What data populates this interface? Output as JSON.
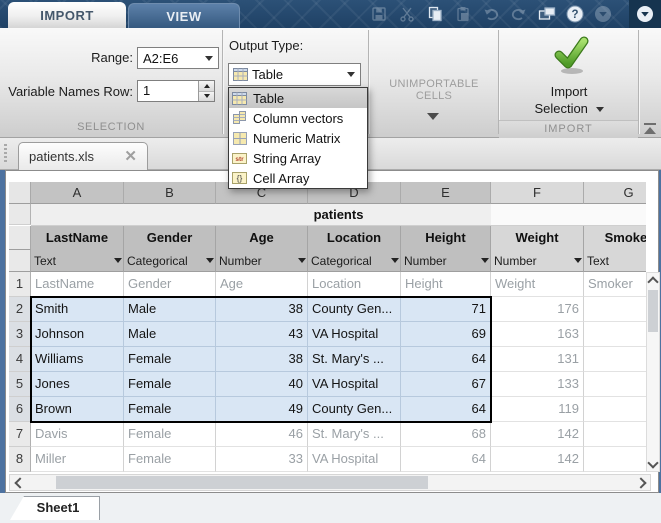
{
  "toolstrip": {
    "tabs": [
      {
        "label": "IMPORT",
        "active": true
      },
      {
        "label": "VIEW",
        "active": false
      }
    ],
    "selection_section": {
      "footer": "SELECTION",
      "range_label": "Range:",
      "range_value": "A2:E6",
      "var_names_label": "Variable Names Row:",
      "var_names_value": "1"
    },
    "output_type_section": {
      "label": "Output Type:",
      "selected": "Table",
      "options": [
        {
          "label": "Table",
          "icon": "table-icon",
          "selected": true
        },
        {
          "label": "Column vectors",
          "icon": "column-vectors-icon",
          "selected": false
        },
        {
          "label": "Numeric Matrix",
          "icon": "numeric-matrix-icon",
          "selected": false
        },
        {
          "label": "String Array",
          "icon": "string-array-icon",
          "selected": false
        },
        {
          "label": "Cell Array",
          "icon": "cell-array-icon",
          "selected": false
        }
      ]
    },
    "unimportable_section": {
      "label": "UNIMPORTABLE CELLS"
    },
    "import_section": {
      "footer": "IMPORT",
      "button_line1": "Import",
      "button_line2": "Selection"
    },
    "accent_colors": {
      "check_green": "#5fae2e",
      "band_navy": "#24486e"
    }
  },
  "document_tab": {
    "title": "patients.xls"
  },
  "spreadsheet": {
    "merged_title": "patients",
    "columns": [
      {
        "letter": "A",
        "name": "LastName",
        "type": "Text",
        "selected": true,
        "align": "left"
      },
      {
        "letter": "B",
        "name": "Gender",
        "type": "Categorical",
        "selected": true,
        "align": "left"
      },
      {
        "letter": "C",
        "name": "Age",
        "type": "Number",
        "selected": true,
        "align": "right"
      },
      {
        "letter": "D",
        "name": "Location",
        "type": "Categorical",
        "selected": true,
        "align": "left"
      },
      {
        "letter": "E",
        "name": "Height",
        "type": "Number",
        "selected": true,
        "align": "right"
      },
      {
        "letter": "F",
        "name": "Weight",
        "type": "Number",
        "selected": false,
        "align": "right"
      },
      {
        "letter": "G",
        "name": "Smoker",
        "type": "Text",
        "selected": false,
        "align": "left"
      }
    ],
    "rows": [
      {
        "num": "1",
        "selected": false,
        "header": true,
        "cells": [
          "LastName",
          "Gender",
          "Age",
          "Location",
          "Height",
          "Weight",
          "Smoker"
        ]
      },
      {
        "num": "2",
        "selected": true,
        "header": false,
        "cells": [
          "Smith",
          "Male",
          "38",
          "County Gen...",
          "71",
          "176",
          ""
        ]
      },
      {
        "num": "3",
        "selected": true,
        "header": false,
        "cells": [
          "Johnson",
          "Male",
          "43",
          "VA Hospital",
          "69",
          "163",
          ""
        ]
      },
      {
        "num": "4",
        "selected": true,
        "header": false,
        "cells": [
          "Williams",
          "Female",
          "38",
          "St. Mary's ...",
          "64",
          "131",
          ""
        ]
      },
      {
        "num": "5",
        "selected": true,
        "header": false,
        "cells": [
          "Jones",
          "Female",
          "40",
          "VA Hospital",
          "67",
          "133",
          ""
        ]
      },
      {
        "num": "6",
        "selected": true,
        "header": false,
        "cells": [
          "Brown",
          "Female",
          "49",
          "County Gen...",
          "64",
          "119",
          ""
        ]
      },
      {
        "num": "7",
        "selected": false,
        "header": false,
        "cells": [
          "Davis",
          "Female",
          "46",
          "St. Mary's ...",
          "68",
          "142",
          ""
        ]
      },
      {
        "num": "8",
        "selected": false,
        "header": false,
        "cells": [
          "Miller",
          "Female",
          "33",
          "VA Hospital",
          "64",
          "142",
          ""
        ]
      }
    ]
  },
  "sheet_tab": {
    "label": "Sheet1"
  }
}
